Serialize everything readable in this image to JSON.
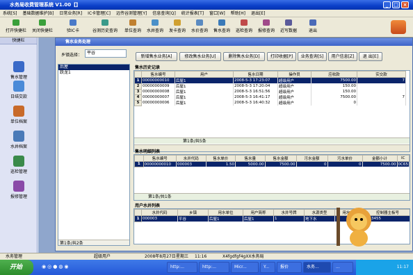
{
  "app": {
    "title": "水务局收费管理系统  V1.00【】",
    "minimize": "_",
    "maximize": "□",
    "close": "×"
  },
  "menu": [
    "系统[S]",
    "基础数据维护[B]",
    "日常业务[R]",
    "IC卡管理[C]",
    "远传谷测管理[Y]",
    "信息查询[Q]",
    "统计报表[T]",
    "窗口[W]",
    "帮助[H]",
    "退出[E]"
  ],
  "toolbar": [
    {
      "label": "打开快捷栏",
      "icon": "open-icon",
      "color": "#3aa03a"
    },
    {
      "label": "关闭快捷栏",
      "icon": "close-panel-icon",
      "color": "#3aa03a"
    },
    {
      "label": "验IC卡",
      "icon": "card-icon",
      "color": "#4a7ac8"
    },
    {
      "label": "谷测历史查询",
      "icon": "history-icon",
      "color": "#3a9a8a"
    },
    {
      "label": "单位查询",
      "icon": "unit-icon",
      "color": "#c08030"
    },
    {
      "label": "水井查询",
      "icon": "well-icon",
      "color": "#4a90c8"
    },
    {
      "label": "发卡查询",
      "icon": "issue-card-icon",
      "color": "#d0a030"
    },
    {
      "label": "水价查询",
      "icon": "price-icon",
      "color": "#5a8ac0"
    },
    {
      "label": "售水查询",
      "icon": "sale-icon",
      "color": "#3a7ab8"
    },
    {
      "label": "巡检查询",
      "icon": "patrol-icon",
      "color": "#c04a4a"
    },
    {
      "label": "报修查询",
      "icon": "repair-icon",
      "color": "#a04a8a"
    },
    {
      "label": "近写数据",
      "icon": "data-icon",
      "color": "#5a5a9a"
    },
    {
      "label": "退出",
      "icon": "exit-icon",
      "color": "#4a6ab8"
    }
  ],
  "leftnav": {
    "header": "快捷栏",
    "items": [
      {
        "label": "售水管理",
        "color": "#3a6ac8"
      },
      {
        "label": "日结交款",
        "color": "#4a8ad8"
      },
      {
        "label": "单位档案",
        "color": "#c86a2a"
      },
      {
        "label": "水井档案",
        "color": "#4a7ab8"
      },
      {
        "label": "巡检管理",
        "color": "#3a8a4a"
      },
      {
        "label": "报修管理",
        "color": "#8a4aa8"
      }
    ]
  },
  "window": {
    "title": "售水业务处理"
  },
  "filter": {
    "label": "乡镇选择：",
    "value": "平谷"
  },
  "towns": {
    "items": [
      "后屋",
      "跃龙1"
    ],
    "footer": "第1条/共2条"
  },
  "buttons": [
    "新增售水业务[A]",
    "修改售水业务[U]",
    "删除售水业务[D]",
    "打印收据[P]",
    "业务查询[S]",
    "用户信息[Z]",
    "退  出[E]"
  ],
  "history": {
    "title": "售水历史记录",
    "columns": [
      "售水编号",
      "用户",
      "售水日期",
      "操作员",
      "应收款",
      "实交款"
    ],
    "rows": [
      [
        "00000000010",
        "后屋1",
        "2008-5-3 17:23:07",
        "超级用户",
        "7500.00",
        "7"
      ],
      [
        "00000000009",
        "后屋1",
        "2008-5-3 17:20:04",
        "超级用户",
        "150.00",
        ""
      ],
      [
        "00000000008",
        "后屋1",
        "2008-5-3 16:51:56",
        "超级用户",
        "150.00",
        ""
      ],
      [
        "00000000007",
        "后屋1",
        "2008-5-3 16:41:17",
        "超级用户",
        "7500.00",
        "7"
      ],
      [
        "00000000006",
        "后屋1",
        "2008-5-3 16:40:32",
        "超级用户",
        "0",
        ""
      ]
    ],
    "footer": "第1条/共5条"
  },
  "detail": {
    "title": "售水明细列表",
    "columns": [
      "售水编号",
      "水井代码",
      "售水单价",
      "售水量",
      "售水金额",
      "污水金额",
      "污水单价",
      "金额小计",
      "IC"
    ],
    "rows": [
      [
        "00000000010",
        "000003",
        "1.50",
        "5000.00",
        "7500.00",
        "0",
        "0",
        "7500.00",
        "0C65"
      ]
    ],
    "footer": "第1条/共1条"
  },
  "wells": {
    "title": "用户水井列表",
    "columns": [
      "水井代码",
      "乡镇",
      "用水单位",
      "用户简称",
      "水井号牌",
      "水源类型",
      "用水类型",
      "控制器主板号"
    ],
    "rows": [
      [
        "000003",
        "平谷",
        "后屋1",
        "后屋1",
        "1",
        "地下水",
        "",
        "123455"
      ]
    ]
  },
  "status": {
    "left": "水务管理",
    "user": "超级用户",
    "date": "2008年8月27日",
    "weekday": "星期三",
    "time": "11:16",
    "org": "X4fgdfgf4gXX水务局"
  },
  "taskbar": {
    "start": "开始",
    "tasks": [
      "http:...",
      "http:...",
      "Micr...",
      "Y...",
      "报价",
      "水务...",
      "..."
    ],
    "clock": "11:17"
  }
}
